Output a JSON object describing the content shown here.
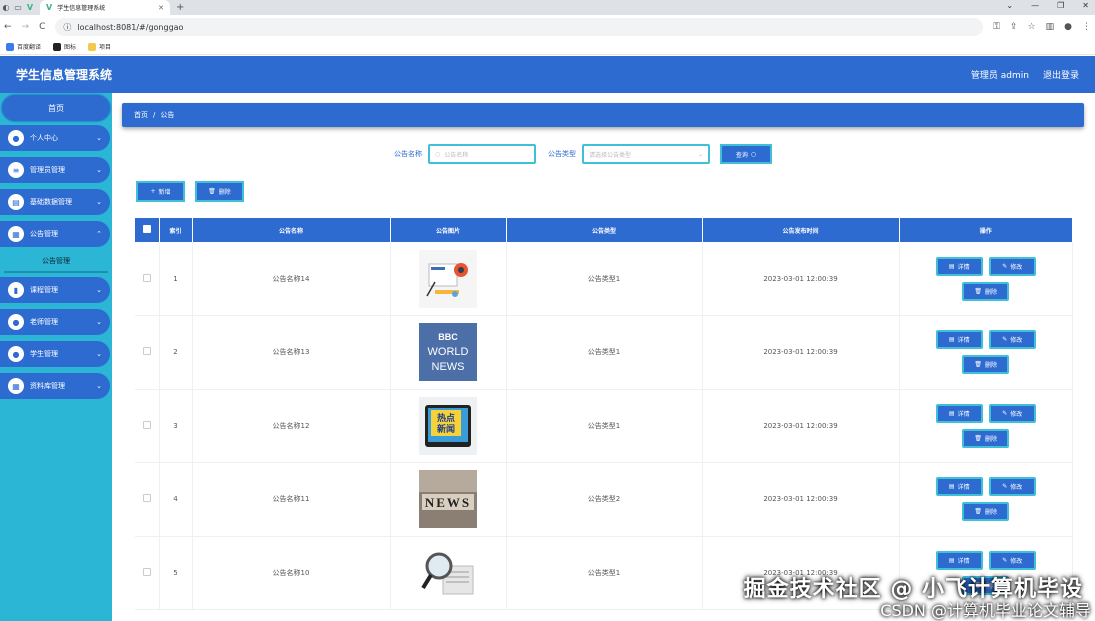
{
  "browser": {
    "tab_title": "学生信息管理系统",
    "url": "localhost:8081/#/gonggao",
    "bookmarks": [
      "百度翻译",
      "图标",
      "项目"
    ]
  },
  "header": {
    "title": "学生信息管理系统",
    "user": "管理员 admin",
    "logout": "退出登录"
  },
  "sidebar": {
    "home": "首页",
    "items": [
      {
        "label": "个人中心",
        "icon": "user-icon"
      },
      {
        "label": "管理员管理",
        "icon": "list-icon"
      },
      {
        "label": "基础数据管理",
        "icon": "doc-icon"
      },
      {
        "label": "公告管理",
        "icon": "grid-icon"
      },
      {
        "label": "课程管理",
        "icon": "chart-icon"
      },
      {
        "label": "老师管理",
        "icon": "user-icon"
      },
      {
        "label": "学生管理",
        "icon": "user-icon"
      },
      {
        "label": "资料库管理",
        "icon": "grid-icon"
      }
    ],
    "sub_active": "公告管理"
  },
  "breadcrumb": {
    "home": "首页",
    "sep": "/",
    "current": "公告"
  },
  "search": {
    "name_label": "公告名称",
    "name_placeholder": "公告名称",
    "type_label": "公告类型",
    "type_placeholder": "请选择公告类型",
    "query_button": "查询"
  },
  "actions": {
    "add": "新增",
    "delete": "删除"
  },
  "table": {
    "headers": [
      "索引",
      "公告名称",
      "公告图片",
      "公告类型",
      "公告发布时间",
      "操作"
    ],
    "rows": [
      {
        "index": "1",
        "name": "公告名称14",
        "type": "公告类型1",
        "time": "2023-03-01 12:00:39",
        "image": "news-icons"
      },
      {
        "index": "2",
        "name": "公告名称13",
        "type": "公告类型1",
        "time": "2023-03-01 12:00:39",
        "image": "bbc-world-news"
      },
      {
        "index": "3",
        "name": "公告名称12",
        "type": "公告类型1",
        "time": "2023-03-01 12:00:39",
        "image": "hot-news"
      },
      {
        "index": "4",
        "name": "公告名称11",
        "type": "公告类型2",
        "time": "2023-03-01 12:00:39",
        "image": "news-blocks"
      },
      {
        "index": "5",
        "name": "公告名称10",
        "type": "公告类型1",
        "time": "2023-03-01 12:00:39",
        "image": "magnifier-news"
      }
    ],
    "row_actions": {
      "detail": "详情",
      "edit": "修改",
      "delete": "删除"
    }
  },
  "image_text": {
    "bbc": "BBC",
    "world": "WORLD",
    "news": "NEWS",
    "hot1": "热点",
    "hot2": "新闻",
    "news_label": "NEWS"
  },
  "watermark": {
    "line1": "掘金技术社区 @ 小飞计算机毕设",
    "line2": "CSDN @计算机毕业论文辅导"
  }
}
